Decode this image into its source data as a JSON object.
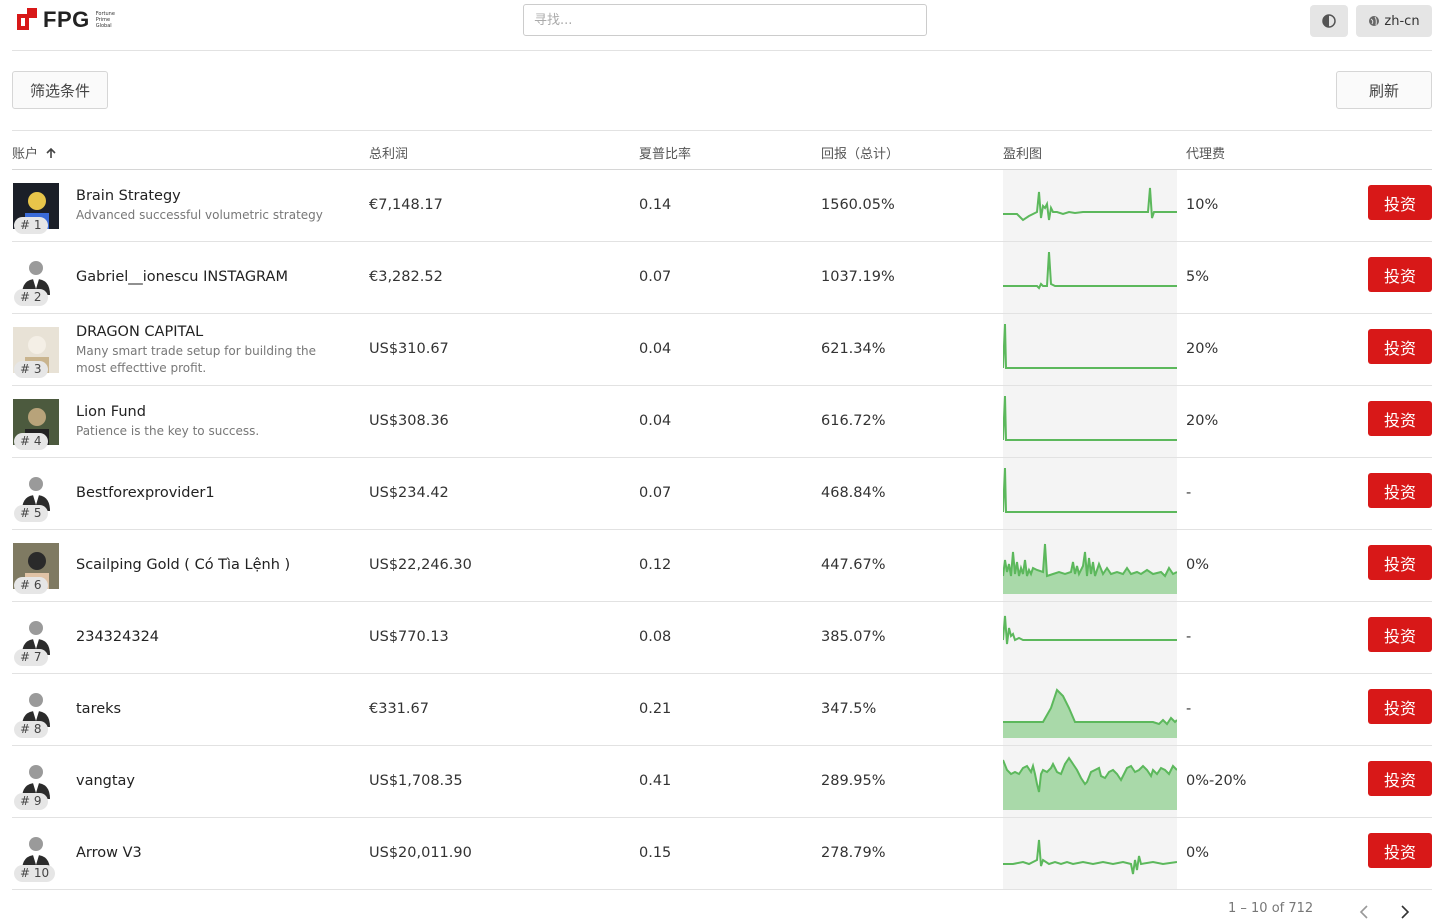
{
  "brand": {
    "name": "FPG",
    "tagline": "Fortune\nPrime\nGlobal",
    "accent": "#d81818"
  },
  "search": {
    "placeholder": "寻找..."
  },
  "lang": {
    "label": "zh-cn"
  },
  "toolbar": {
    "filter_label": "筛选条件",
    "refresh_label": "刷新"
  },
  "table": {
    "headers": {
      "account": "账户",
      "profit": "总利润",
      "sharpe": "夏普比率",
      "return": "回报（总计）",
      "chart": "盈利图",
      "fee": "代理费"
    },
    "invest_label": "投资",
    "rows": [
      {
        "rank": "# 1",
        "name": "Brain Strategy",
        "desc": "Advanced successful volumetric strategy",
        "profit": "€7,148.17",
        "sharpe": "0.14",
        "return": "1560.05%",
        "fee": "10%",
        "avatar": "photo-dark"
      },
      {
        "rank": "# 2",
        "name": "Gabriel__ionescu INSTAGRAM",
        "desc": "",
        "profit": "€3,282.52",
        "sharpe": "0.07",
        "return": "1037.19%",
        "fee": "5%",
        "avatar": "default"
      },
      {
        "rank": "# 3",
        "name": "DRAGON CAPITAL",
        "desc": "Many smart trade setup for building the most effecttive profit.",
        "profit": "US$310.67",
        "sharpe": "0.04",
        "return": "621.34%",
        "fee": "20%",
        "avatar": "photo-light"
      },
      {
        "rank": "# 4",
        "name": "Lion Fund",
        "desc": "Patience is the key to success.",
        "profit": "US$308.36",
        "sharpe": "0.04",
        "return": "616.72%",
        "fee": "20%",
        "avatar": "photo-street"
      },
      {
        "rank": "# 5",
        "name": "Bestforexprovider1",
        "desc": "",
        "profit": "US$234.42",
        "sharpe": "0.07",
        "return": "468.84%",
        "fee": "-",
        "avatar": "default"
      },
      {
        "rank": "# 6",
        "name": "Scailping Gold ( Có Tìa Lệnh )",
        "desc": "",
        "profit": "US$22,246.30",
        "sharpe": "0.12",
        "return": "447.67%",
        "fee": "0%",
        "avatar": "photo-person"
      },
      {
        "rank": "# 7",
        "name": "234324324",
        "desc": "",
        "profit": "US$770.13",
        "sharpe": "0.08",
        "return": "385.07%",
        "fee": "-",
        "avatar": "default"
      },
      {
        "rank": "# 8",
        "name": "tareks",
        "desc": "",
        "profit": "€331.67",
        "sharpe": "0.21",
        "return": "347.5%",
        "fee": "-",
        "avatar": "default"
      },
      {
        "rank": "# 9",
        "name": "vangtay",
        "desc": "",
        "profit": "US$1,708.35",
        "sharpe": "0.41",
        "return": "289.95%",
        "fee": "0%-20%",
        "avatar": "default"
      },
      {
        "rank": "# 10",
        "name": "Arrow V3",
        "desc": "",
        "profit": "US$20,011.90",
        "sharpe": "0.15",
        "return": "278.79%",
        "fee": "0%",
        "avatar": "default"
      }
    ]
  },
  "pager": {
    "text": "1 – 10 of 712"
  }
}
